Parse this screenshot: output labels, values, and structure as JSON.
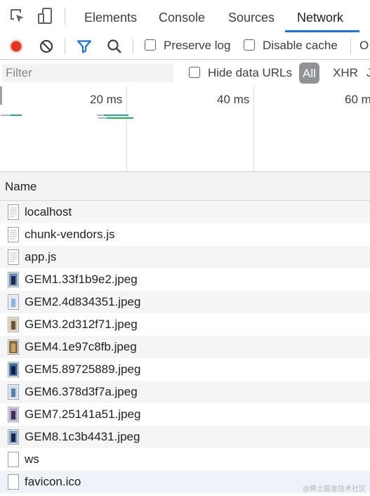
{
  "tabs": [
    {
      "label": "Elements",
      "active": false
    },
    {
      "label": "Console",
      "active": false
    },
    {
      "label": "Sources",
      "active": false
    },
    {
      "label": "Network",
      "active": true
    }
  ],
  "toolbar": {
    "preserve_log_label": "Preserve log",
    "disable_cache_label": "Disable cache",
    "overflow_label": "O",
    "record_color": "#e8341c",
    "accent": "#1a73e8"
  },
  "filter": {
    "placeholder": "Filter",
    "hide_data_urls_label": "Hide data URLs",
    "all_label": "All",
    "xhr_label": "XHR",
    "next_label": "J"
  },
  "overview": {
    "ticks": [
      "20 ms",
      "40 ms",
      "60 m"
    ]
  },
  "table": {
    "name_header": "Name",
    "rows": [
      {
        "name": "localhost",
        "icon": "document-icon"
      },
      {
        "name": "chunk-vendors.js",
        "icon": "script-file-icon"
      },
      {
        "name": "app.js",
        "icon": "script-file-icon"
      },
      {
        "name": "GEM1.33f1b9e2.jpeg",
        "icon": "image-thumbnail-icon"
      },
      {
        "name": "GEM2.4d834351.jpeg",
        "icon": "image-thumbnail-icon"
      },
      {
        "name": "GEM3.2d312f71.jpeg",
        "icon": "image-thumbnail-icon"
      },
      {
        "name": "GEM4.1e97c8fb.jpeg",
        "icon": "image-thumbnail-icon"
      },
      {
        "name": "GEM5.89725889.jpeg",
        "icon": "image-thumbnail-icon"
      },
      {
        "name": "GEM6.378d3f7a.jpeg",
        "icon": "image-thumbnail-icon"
      },
      {
        "name": "GEM7.25141a51.jpeg",
        "icon": "image-thumbnail-icon"
      },
      {
        "name": "GEM8.1c3b4431.jpeg",
        "icon": "image-thumbnail-icon"
      },
      {
        "name": "ws",
        "icon": "blank-file-icon"
      },
      {
        "name": "favicon.ico",
        "icon": "blank-file-icon"
      }
    ]
  },
  "watermark": "@稀土掘金技术社区"
}
